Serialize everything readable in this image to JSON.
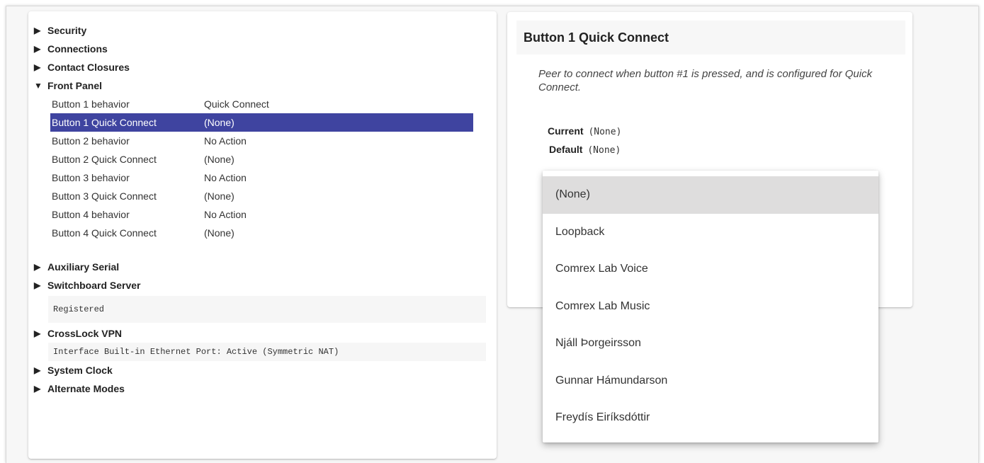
{
  "tree": {
    "top_sections": [
      {
        "label": "Security",
        "arrow": "▶"
      },
      {
        "label": "Connections",
        "arrow": "▶"
      },
      {
        "label": "Contact Closures",
        "arrow": "▶"
      }
    ],
    "front_panel": {
      "label": "Front Panel",
      "arrow": "▼",
      "rows": [
        {
          "label": "Button 1 behavior",
          "value": "Quick Connect"
        },
        {
          "label": "Button 1 Quick Connect",
          "value": "(None)"
        },
        {
          "label": "Button 2 behavior",
          "value": "No Action"
        },
        {
          "label": "Button 2 Quick Connect",
          "value": "(None)"
        },
        {
          "label": "Button 3 behavior",
          "value": "No Action"
        },
        {
          "label": "Button 3 Quick Connect",
          "value": "(None)"
        },
        {
          "label": "Button 4 behavior",
          "value": "No Action"
        },
        {
          "label": "Button 4 Quick Connect",
          "value": "(None)"
        }
      ]
    },
    "auxiliary_serial": {
      "label": "Auxiliary Serial",
      "arrow": "▶"
    },
    "switchboard": {
      "label": "Switchboard Server",
      "arrow": "▶",
      "status": "Registered"
    },
    "crosslock": {
      "label": "CrossLock VPN",
      "arrow": "▶",
      "status": "Interface Built-in Ethernet Port: Active (Symmetric NAT)"
    },
    "system_clock": {
      "label": "System Clock",
      "arrow": "▶"
    },
    "alternate_modes": {
      "label": "Alternate Modes",
      "arrow": "▶"
    }
  },
  "detail": {
    "title": "Button 1 Quick Connect",
    "description": "Peer to connect when button #1 is pressed, and is configured for Quick Connect.",
    "current_label": "Current",
    "current_value": "(None)",
    "default_label": "Default",
    "default_value": "(None)"
  },
  "dropdown": {
    "options": [
      "(None)",
      "Loopback",
      "Comrex Lab Voice",
      "Comrex Lab Music",
      "Njáll Þorgeirsson",
      "Gunnar Hámundarson",
      "Freydís Eiríksdóttir"
    ],
    "selected": "(None)"
  },
  "colors": {
    "selected_row": "#3f44a0",
    "dropdown_active": "#dedddd"
  }
}
